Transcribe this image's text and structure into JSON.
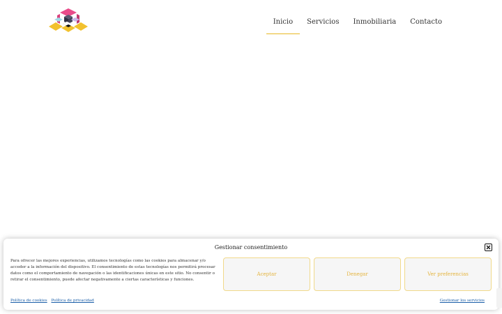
{
  "nav": {
    "items": [
      {
        "label": "Inicio",
        "active": true
      },
      {
        "label": "Servicios",
        "active": false
      },
      {
        "label": "Inmobiliaria",
        "active": false
      },
      {
        "label": "Contacto",
        "active": false
      }
    ]
  },
  "consent": {
    "title": "Gestionar consentimiento",
    "text": "Para ofrecer las mejores experiencias, utilizamos tecnologías como las cookies para almacenar y/o acceder a la información del dispositivo. El consentimiento de estas tecnologías nos permitirá procesar datos como el comportamiento de navegación o las identificaciones únicas en este sitio. No consentir o retirar el consentimiento, puede afectar negativamente a ciertas características y funciones.",
    "accept_label": "Aceptar",
    "deny_label": "Denegar",
    "prefs_label": "Ver preferencias",
    "cookie_policy_label": "Política de cookies",
    "privacy_policy_label": "Política de privacidad",
    "manage_label": "Gestionar los servicios"
  },
  "colors": {
    "accent": "#e8b923",
    "button_text": "#e4b43f",
    "link": "#1a5ea8"
  }
}
